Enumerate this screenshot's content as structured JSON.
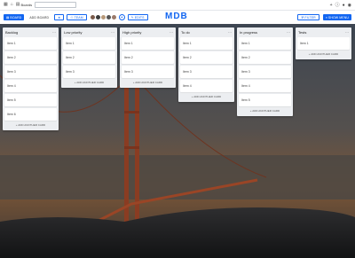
{
  "navbar": {
    "search_placeholder": "",
    "home_label": "Boards",
    "icons": [
      "home-icon",
      "grid-icon",
      "search-icon",
      "plus-icon",
      "info-icon",
      "bell-icon",
      "user-icon"
    ]
  },
  "toolbar": {
    "board_label": "Board",
    "add_board_label": "Add board",
    "star_label": "★",
    "team_label": "Team",
    "edit_label": "Edits",
    "brand": "MDB",
    "filter_label": "Filter",
    "show_menu_label": "Show menu"
  },
  "lists": [
    {
      "title": "Backlog",
      "cards": [
        "Item 1",
        "Item 2",
        "Item 3",
        "Item 4",
        "Item 5",
        "Item 6"
      ],
      "add_label": "+ Add another card"
    },
    {
      "title": "Low priority",
      "cards": [
        "Item 1",
        "Item 2",
        "Item 3"
      ],
      "add_label": "+ Add another card"
    },
    {
      "title": "High priority",
      "cards": [
        "Item 1",
        "Item 2",
        "Item 3"
      ],
      "add_label": "+ Add another card"
    },
    {
      "title": "To do",
      "cards": [
        "Item 1",
        "Item 2",
        "Item 3",
        "Item 4"
      ],
      "add_label": "+ Add another card"
    },
    {
      "title": "In progress",
      "cards": [
        "Item 1",
        "Item 2",
        "Item 3",
        "Item 4",
        "Item 5"
      ],
      "add_label": "+ Add another card"
    },
    {
      "title": "Tests",
      "cards": [
        "Item 1"
      ],
      "add_label": "+ Add another card"
    }
  ],
  "colors": {
    "accent": "#1266f1"
  }
}
